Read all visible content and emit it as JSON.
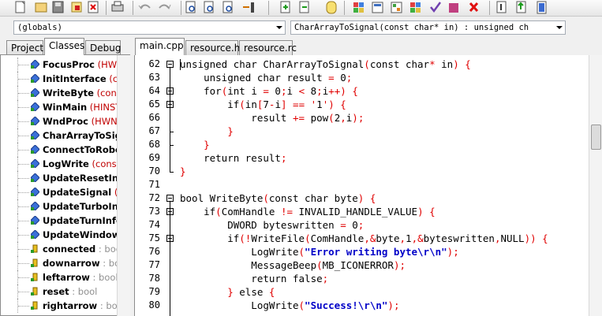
{
  "toolbar": {
    "buttons": [
      "new-file",
      "open-file",
      "save-file",
      "save-all",
      "close-file",
      "print",
      "undo",
      "redo",
      "find",
      "find-next",
      "replace",
      "goto-line",
      "add-to-project",
      "remove-from-project",
      "project-options",
      "grid",
      "compile",
      "run",
      "compile-run",
      "check-syntax",
      "stop",
      "debug-in",
      "debug-out",
      "help"
    ]
  },
  "scope_combo": "(globals)",
  "function_combo": "CharArrayToSignal(const char* in) : unsigned ch",
  "left_tabs": [
    "Project",
    "Classes",
    "Debug"
  ],
  "editor_tabs": [
    "main.cpp",
    "resource.h",
    "resource.rc"
  ],
  "tree": [
    {
      "name": "FocusProc",
      "detail": " (HWND",
      "kind": "func"
    },
    {
      "name": "InitInterface",
      "detail": " (cor",
      "kind": "func"
    },
    {
      "name": "WriteByte",
      "detail": " (const c",
      "kind": "func"
    },
    {
      "name": "WinMain",
      "detail": " (HINSTAN",
      "kind": "func"
    },
    {
      "name": "WndProc",
      "detail": " (HWND h",
      "kind": "func"
    },
    {
      "name": "CharArrayToSign",
      "detail": "",
      "kind": "func"
    },
    {
      "name": "ConnectToRobot",
      "detail": "",
      "kind": "func"
    },
    {
      "name": "LogWrite",
      "detail": " (const ch",
      "kind": "func"
    },
    {
      "name": "UpdateResetInfo",
      "detail": "",
      "kind": "func"
    },
    {
      "name": "UpdateSignal",
      "detail": " () :",
      "kind": "func"
    },
    {
      "name": "UpdateTurboInfo",
      "detail": "",
      "kind": "func"
    },
    {
      "name": "UpdateTurnInfo",
      "detail": "",
      "kind": "func"
    },
    {
      "name": "UpdateWindowC",
      "detail": "",
      "kind": "func"
    },
    {
      "name": "connected",
      "detail": " : bool",
      "kind": "var"
    },
    {
      "name": "downarrow",
      "detail": " : bool",
      "kind": "var"
    },
    {
      "name": "leftarrow",
      "detail": " : bool",
      "kind": "var"
    },
    {
      "name": "reset",
      "detail": " : bool",
      "kind": "var"
    },
    {
      "name": "rightarrow",
      "detail": " : bool",
      "kind": "var"
    }
  ],
  "line_numbers": [
    "62",
    "63",
    "64",
    "65",
    "66",
    "67",
    "68",
    "69",
    "70",
    "71",
    "72",
    "73",
    "74",
    "75",
    "76",
    "77",
    "78",
    "79",
    "80"
  ],
  "code_lines": [
    "unsigned char CharArrayToSignal(const char* in) {",
    "    unsigned char result = 0;",
    "    for(int i = 0;i < 8;i++) {",
    "        if(in[7-i] == '1') {",
    "            result += pow(2,i);",
    "        }",
    "    }",
    "    return result;",
    "}",
    "",
    "bool WriteByte(const char byte) {",
    "    if(ComHandle != INVALID_HANDLE_VALUE) {",
    "        DWORD byteswritten = 0;",
    "        if(!WriteFile(ComHandle,&byte,1,&byteswritten,NULL)) {",
    "            LogWrite(\"Error writing byte\\r\\n\");",
    "            MessageBeep(MB_ICONERROR);",
    "            return false;",
    "        } else {",
    "            LogWrite(\"Success!\\r\\n\");"
  ],
  "colors": {
    "operator": "#e00000",
    "string": "#0000c8",
    "detail": "#c00000",
    "var_detail": "#909090"
  }
}
